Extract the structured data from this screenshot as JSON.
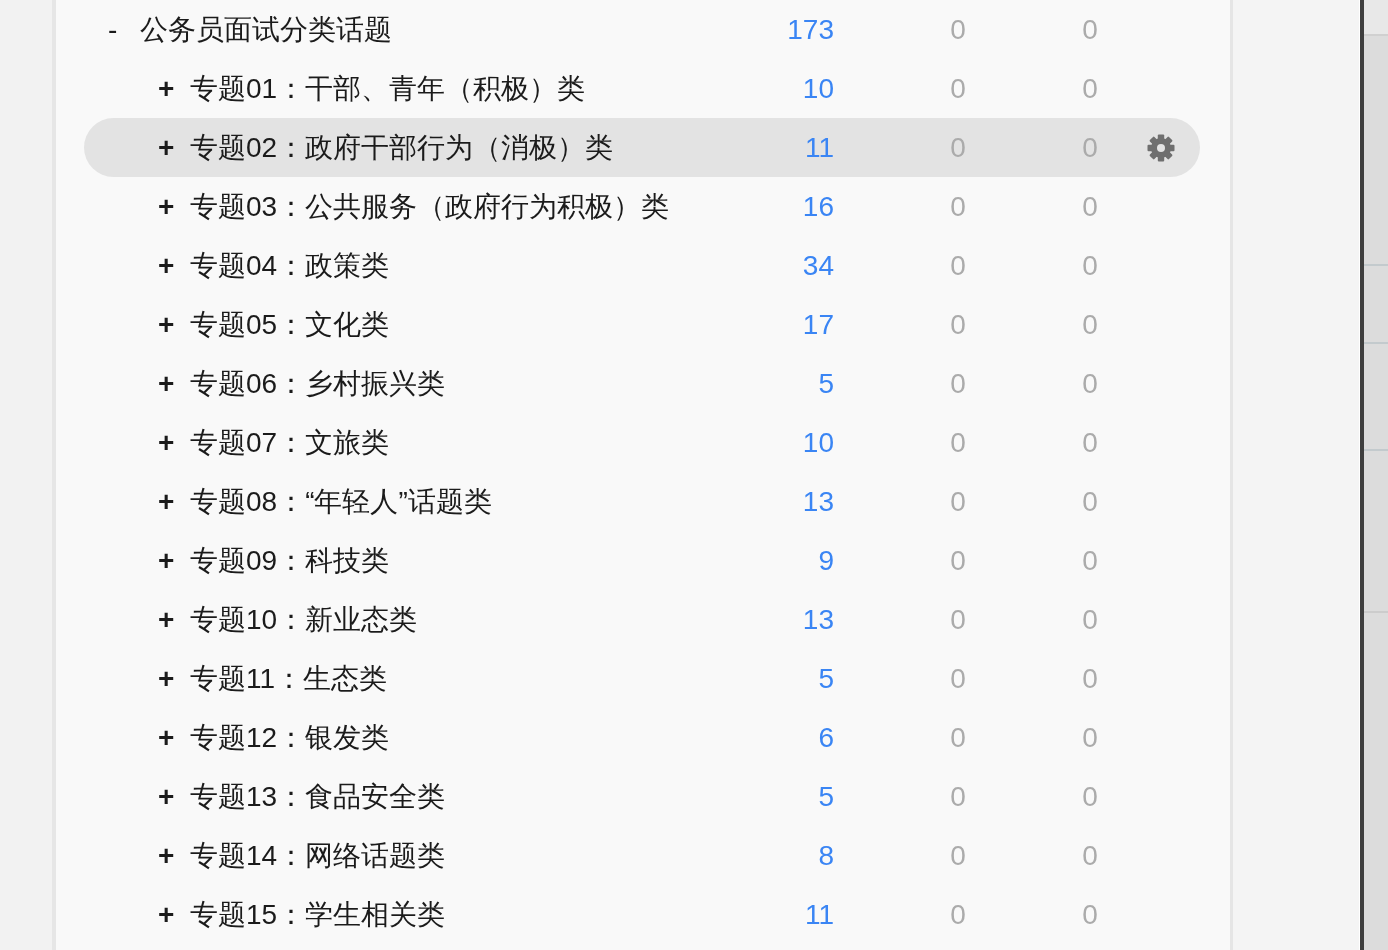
{
  "tree": {
    "items": [
      {
        "toggle": "-",
        "label": "公务员面试分类话题",
        "column_1": "173",
        "column_2": "0",
        "column_3": "0",
        "expanded": true,
        "selected": false,
        "children": [
          {
            "toggle": "+",
            "label": "专题01：干部、青年（积极）类",
            "column_1": "10",
            "column_2": "0",
            "column_3": "0",
            "expanded": false,
            "selected": false
          },
          {
            "toggle": "+",
            "label": "专题02：政府干部行为（消极）类",
            "column_1": "11",
            "column_2": "0",
            "column_3": "0",
            "expanded": false,
            "selected": true
          },
          {
            "toggle": "+",
            "label": "专题03：公共服务（政府行为积极）类",
            "column_1": "16",
            "column_2": "0",
            "column_3": "0",
            "expanded": false,
            "selected": false
          },
          {
            "toggle": "+",
            "label": "专题04：政策类",
            "column_1": "34",
            "column_2": "0",
            "column_3": "0",
            "expanded": false,
            "selected": false
          },
          {
            "toggle": "+",
            "label": "专题05：文化类",
            "column_1": "17",
            "column_2": "0",
            "column_3": "0",
            "expanded": false,
            "selected": false
          },
          {
            "toggle": "+",
            "label": "专题06：乡村振兴类",
            "column_1": "5",
            "column_2": "0",
            "column_3": "0",
            "expanded": false,
            "selected": false
          },
          {
            "toggle": "+",
            "label": "专题07：文旅类",
            "column_1": "10",
            "column_2": "0",
            "column_3": "0",
            "expanded": false,
            "selected": false
          },
          {
            "toggle": "+",
            "label": "专题08：“年轻人”话题类",
            "column_1": "13",
            "column_2": "0",
            "column_3": "0",
            "expanded": false,
            "selected": false
          },
          {
            "toggle": "+",
            "label": "专题09：科技类",
            "column_1": "9",
            "column_2": "0",
            "column_3": "0",
            "expanded": false,
            "selected": false
          },
          {
            "toggle": "+",
            "label": "专题10：新业态类",
            "column_1": "13",
            "column_2": "0",
            "column_3": "0",
            "expanded": false,
            "selected": false
          },
          {
            "toggle": "+",
            "label": "专题11：生态类",
            "column_1": "5",
            "column_2": "0",
            "column_3": "0",
            "expanded": false,
            "selected": false
          },
          {
            "toggle": "+",
            "label": "专题12：银发类",
            "column_1": "6",
            "column_2": "0",
            "column_3": "0",
            "expanded": false,
            "selected": false
          },
          {
            "toggle": "+",
            "label": "专题13：食品安全类",
            "column_1": "5",
            "column_2": "0",
            "column_3": "0",
            "expanded": false,
            "selected": false
          },
          {
            "toggle": "+",
            "label": "专题14：网络话题类",
            "column_1": "8",
            "column_2": "0",
            "column_3": "0",
            "expanded": false,
            "selected": false
          },
          {
            "toggle": "+",
            "label": "专题15：学生相关类",
            "column_1": "11",
            "column_2": "0",
            "column_3": "0",
            "expanded": false,
            "selected": false
          }
        ]
      }
    ]
  }
}
